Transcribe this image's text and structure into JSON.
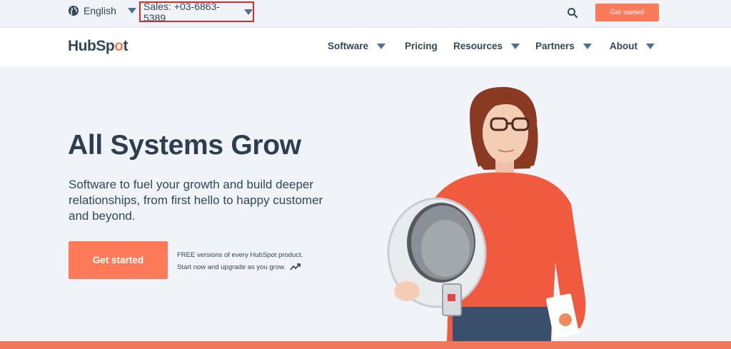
{
  "utility": {
    "language": "English",
    "sales": "Sales: +03-6863-5389",
    "cta": "Get started",
    "icons": {
      "globe": "globe-icon",
      "search": "search-icon"
    }
  },
  "nav": {
    "logo": {
      "pre": "HubSp",
      "o": "o",
      "post": "t"
    },
    "items": [
      {
        "label": "Software",
        "dropdown": true
      },
      {
        "label": "Pricing",
        "dropdown": false
      },
      {
        "label": "Resources",
        "dropdown": true
      },
      {
        "label": "Partners",
        "dropdown": true
      },
      {
        "label": "About",
        "dropdown": true
      }
    ]
  },
  "hero": {
    "title": "All Systems Grow",
    "subtitle": "Software to fuel your growth and build deeper relationships, from first hello to happy customer and beyond.",
    "cta": "Get started",
    "note_line1": "FREE versions of every HubSpot product.",
    "note_line2": "Start now and upgrade as you grow."
  },
  "colors": {
    "accent": "#ff7a59",
    "text": "#33475b",
    "highlight_box": "#d92b2b"
  }
}
